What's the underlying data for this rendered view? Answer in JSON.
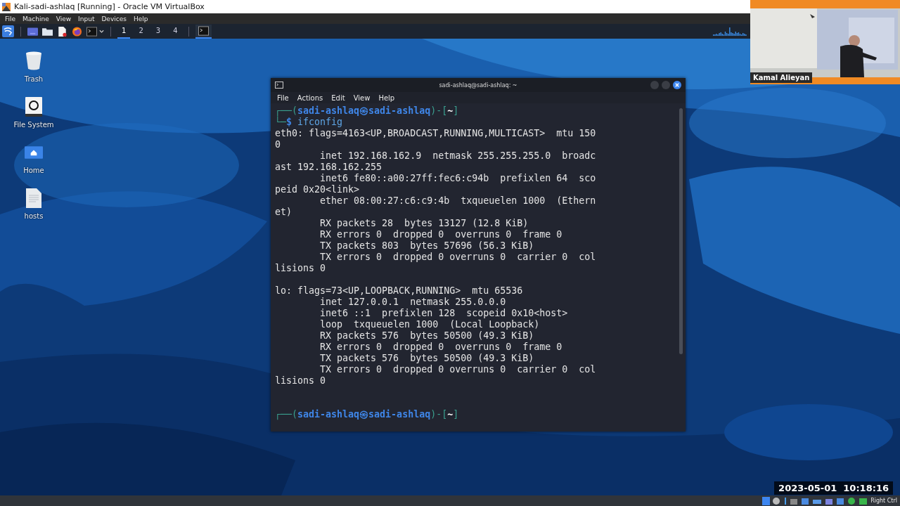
{
  "vbox": {
    "title": "Kali-sadi-ashlaq [Running] - Oracle VM VirtualBox",
    "menu": [
      "File",
      "Machine",
      "View",
      "Input",
      "Devices",
      "Help"
    ],
    "host_key": "Right Ctrl"
  },
  "panel": {
    "workspaces": [
      {
        "label": "1",
        "selected": true
      },
      {
        "label": "2",
        "selected": false
      },
      {
        "label": "3",
        "selected": false
      },
      {
        "label": "4",
        "selected": false
      }
    ]
  },
  "desktop_icons": [
    {
      "label": "Trash",
      "kind": "trash"
    },
    {
      "label": "File System",
      "kind": "drive"
    },
    {
      "label": "Home",
      "kind": "home"
    },
    {
      "label": "hosts",
      "kind": "file"
    }
  ],
  "terminal": {
    "title": "sadi-ashlaq@sadi-ashlaq: ~",
    "menu": [
      "File",
      "Actions",
      "Edit",
      "View",
      "Help"
    ],
    "lines": [
      {
        "kind": "prompt",
        "parts": [
          {
            "kind": "frame",
            "text": "┌──("
          },
          {
            "kind": "user",
            "text": "sadi-ashlaq"
          },
          {
            "kind": "user",
            "text": "㉿"
          },
          {
            "kind": "user",
            "text": "sadi-ashlaq"
          },
          {
            "kind": "frame",
            "text": ")-["
          },
          {
            "kind": "dir",
            "text": "~"
          },
          {
            "kind": "frame",
            "text": "]"
          }
        ]
      },
      {
        "kind": "command",
        "parts": [
          {
            "kind": "frame",
            "text": "└─"
          },
          {
            "kind": "user",
            "text": "$ "
          },
          {
            "kind": "cmd",
            "text": "ifconfig"
          }
        ]
      },
      {
        "kind": "output",
        "text": "eth0: flags=4163<UP,BROADCAST,RUNNING,MULTICAST>  mtu 150"
      },
      {
        "kind": "output",
        "text": "0"
      },
      {
        "kind": "output",
        "text": "        inet 192.168.162.9  netmask 255.255.255.0  broadc"
      },
      {
        "kind": "output",
        "text": "ast 192.168.162.255"
      },
      {
        "kind": "output",
        "text": "        inet6 fe80::a00:27ff:fec6:c94b  prefixlen 64  sco"
      },
      {
        "kind": "output",
        "text": "peid 0x20<link>"
      },
      {
        "kind": "output",
        "text": "        ether 08:00:27:c6:c9:4b  txqueuelen 1000  (Ethern"
      },
      {
        "kind": "output",
        "text": "et)"
      },
      {
        "kind": "output",
        "text": "        RX packets 28  bytes 13127 (12.8 KiB)"
      },
      {
        "kind": "output",
        "text": "        RX errors 0  dropped 0  overruns 0  frame 0"
      },
      {
        "kind": "output",
        "text": "        TX packets 803  bytes 57696 (56.3 KiB)"
      },
      {
        "kind": "output",
        "text": "        TX errors 0  dropped 0 overruns 0  carrier 0  col"
      },
      {
        "kind": "output",
        "text": "lisions 0"
      },
      {
        "kind": "blank"
      },
      {
        "kind": "output",
        "text": "lo: flags=73<UP,LOOPBACK,RUNNING>  mtu 65536"
      },
      {
        "kind": "output",
        "text": "        inet 127.0.0.1  netmask 255.0.0.0"
      },
      {
        "kind": "output",
        "text": "        inet6 ::1  prefixlen 128  scopeid 0x10<host>"
      },
      {
        "kind": "output",
        "text": "        loop  txqueuelen 1000  (Local Loopback)"
      },
      {
        "kind": "output",
        "text": "        RX packets 576  bytes 50500 (49.3 KiB)"
      },
      {
        "kind": "output",
        "text": "        RX errors 0  dropped 0  overruns 0  frame 0"
      },
      {
        "kind": "output",
        "text": "        TX packets 576  bytes 50500 (49.3 KiB)"
      },
      {
        "kind": "output",
        "text": "        TX errors 0  dropped 0 overruns 0  carrier 0  col"
      },
      {
        "kind": "output",
        "text": "lisions 0"
      },
      {
        "kind": "blank"
      },
      {
        "kind": "blank"
      },
      {
        "kind": "prompt",
        "parts": [
          {
            "kind": "frame",
            "text": "┌──("
          },
          {
            "kind": "user",
            "text": "sadi-ashlaq"
          },
          {
            "kind": "user",
            "text": "㉿"
          },
          {
            "kind": "user",
            "text": "sadi-ashlaq"
          },
          {
            "kind": "frame",
            "text": ")-["
          },
          {
            "kind": "dir",
            "text": "~"
          },
          {
            "kind": "frame",
            "text": "]"
          }
        ]
      }
    ]
  },
  "video": {
    "kind": "picture",
    "presenter": "Kamal Alieyan"
  },
  "timestamp": "2023-05-01  10:18:16"
}
